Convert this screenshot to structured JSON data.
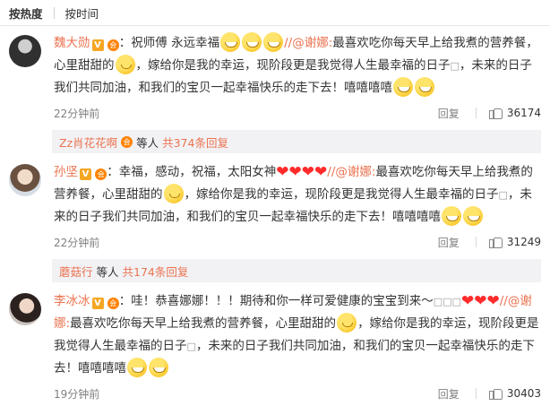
{
  "sortbar": {
    "hot": "按热度",
    "time": "按时间"
  },
  "comments": [
    {
      "user": "魏大勋",
      "seg_a": "：祝师傅 永远幸福",
      "at": "//@谢娜:",
      "seg_b": "最喜欢吃你每天早上给我煮的营养餐，心里甜甜的",
      "seg_c": "，嫁给你是我的幸运，现阶段更是我觉得人生最幸福的日子",
      "seg_d": "，未来的日子我们共同加油，和我们的宝贝一起幸福快乐的走下去！嘻嘻嘻嘻",
      "time": "22分钟前",
      "reply": "回复",
      "likes": "36174",
      "sub": {
        "user": "Zz肖花花啊",
        "mid": "等人",
        "count": "共374条回复"
      }
    },
    {
      "user": "孙坚",
      "seg_a": "：幸福，感动，祝福，太阳女神",
      "at": "//@谢娜:",
      "seg_b": "最喜欢吃你每天早上给我煮的营养餐，心里甜甜的",
      "seg_c": "，嫁给你是我的幸运，现阶段更是我觉得人生最幸福的日子",
      "seg_d": "，未来的日子我们共同加油，和我们的宝贝一起幸福快乐的走下去！嘻嘻嘻嘻",
      "time": "22分钟前",
      "reply": "回复",
      "likes": "31249",
      "sub": {
        "user": "蘑菇行",
        "mid": "等人",
        "count": "共174条回复"
      }
    },
    {
      "user": "李冰冰",
      "seg_a": "：哇！恭喜娜娜！！！期待和你一样可爱健康的宝宝到来～",
      "at": "//@谢娜:",
      "seg_b": "最喜欢吃你每天早上给我煮的营养餐，心里甜甜的",
      "seg_c": "，嫁给你是我的幸运，现阶段更是我觉得人生最幸福的日子",
      "seg_d": "，未来的日子我们共同加油，和我们的宝贝一起幸福快乐的走下去！嘻嘻嘻嘻",
      "time": "19分钟前",
      "reply": "回复",
      "likes": "30403"
    }
  ],
  "glyphs": {
    "tofu": "□",
    "tofu3": "□□□",
    "v": "V",
    "vip": "会"
  },
  "icons": {
    "like": "thumb-up-icon",
    "verified": "verified-badge-icon",
    "member": "vip-member-icon"
  }
}
